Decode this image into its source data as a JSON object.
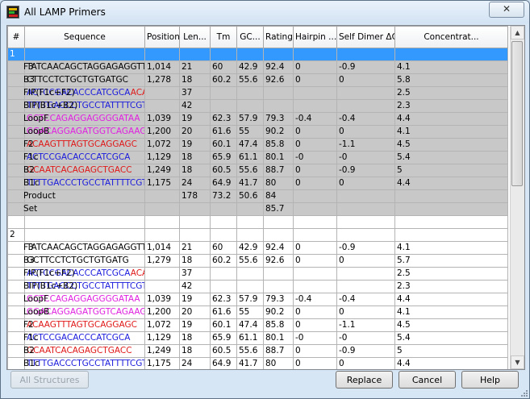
{
  "window": {
    "title": "All LAMP Primers",
    "close_glyph": "✕"
  },
  "colors": {
    "blue_seq": "#1a1adc",
    "red_seq": "#e01818",
    "magenta_seq": "#e020e0",
    "selection": "#3399ff",
    "row_gray": "#c8c8c8"
  },
  "columns": [
    "#",
    "Sequence",
    "Position",
    "Len...",
    "Tm",
    "GC...",
    "Rating",
    "Hairpin ...",
    "Self Dimer ΔG",
    "Concentrat..."
  ],
  "groups": [
    {
      "index": "1",
      "selected": true,
      "rows": [
        {
          "name": "F3",
          "seq": [
            {
              "t": "TATCAACAGCTAGGAGAGGTT",
              "c": "black"
            }
          ],
          "pos": "1,014",
          "len": "21",
          "tm": "60",
          "gc": "42.9",
          "rating": "92.4",
          "hairpin": "0",
          "dimer": "-0.9",
          "conc": "4.1",
          "light": false
        },
        {
          "name": "B3",
          "seq": [
            {
              "t": "CTTCCTCTGCTGTGATGC",
              "c": "black"
            }
          ],
          "pos": "1,278",
          "len": "18",
          "tm": "60.2",
          "gc": "55.6",
          "rating": "92.6",
          "hairpin": "0",
          "dimer": "0",
          "conc": "5.8",
          "light": false
        },
        {
          "name": "FIP(F1c+F2)",
          "seq": [
            {
              "t": "ACTCCGACACCCATCGCA",
              "c": "blue"
            },
            {
              "t": "ACAAGTTTAGTGCAGGAGC",
              "c": "red"
            }
          ],
          "pos": "",
          "len": "37",
          "tm": "",
          "gc": "",
          "rating": "",
          "hairpin": "",
          "dimer": "",
          "conc": "2.5",
          "light": false
        },
        {
          "name": "BIP(B1c+B2)",
          "seq": [
            {
              "t": "TTTTGACCCTGCCTATTTTCGTCGCAATCACAGAGCTGACC",
              "c": "blue"
            }
          ],
          "pos": "",
          "len": "42",
          "tm": "",
          "gc": "",
          "rating": "",
          "hairpin": "",
          "dimer": "",
          "conc": "2.3",
          "light": false
        },
        {
          "name": "LoopF",
          "seq": [
            {
              "t": "GCTCCAGAGGAGGGGATAA",
              "c": "magenta"
            }
          ],
          "pos": "1,039",
          "len": "19",
          "tm": "62.3",
          "gc": "57.9",
          "rating": "79.3",
          "hairpin": "-0.4",
          "dimer": "-0.4",
          "conc": "4.4",
          "light": false
        },
        {
          "name": "LoopB",
          "seq": [
            {
              "t": "GGACAGGAGATGGTCAGAAG",
              "c": "magenta"
            }
          ],
          "pos": "1,200",
          "len": "20",
          "tm": "61.6",
          "gc": "55",
          "rating": "90.2",
          "hairpin": "0",
          "dimer": "0",
          "conc": "4.1",
          "light": false
        },
        {
          "name": "F2",
          "seq": [
            {
              "t": "ACAAGTTTAGTGCAGGAGC",
              "c": "red"
            }
          ],
          "pos": "1,072",
          "len": "19",
          "tm": "60.1",
          "gc": "47.4",
          "rating": "85.8",
          "hairpin": "0",
          "dimer": "-1.1",
          "conc": "4.5",
          "light": false
        },
        {
          "name": "F1c",
          "seq": [
            {
              "t": "ACTCCGACACCCATCGCA",
              "c": "blue"
            }
          ],
          "pos": "1,129",
          "len": "18",
          "tm": "65.9",
          "gc": "61.1",
          "rating": "80.1",
          "hairpin": "-0",
          "dimer": "-0",
          "conc": "5.4",
          "light": false
        },
        {
          "name": "B2",
          "seq": [
            {
              "t": "GCAATCACAGAGCTGACC",
              "c": "red"
            }
          ],
          "pos": "1,249",
          "len": "18",
          "tm": "60.5",
          "gc": "55.6",
          "rating": "88.7",
          "hairpin": "0",
          "dimer": "-0.9",
          "conc": "5",
          "light": false
        },
        {
          "name": "B1c",
          "seq": [
            {
              "t": "TTTTGACCCTGCCTATTTTCGTC",
              "c": "blue"
            }
          ],
          "pos": "1,175",
          "len": "24",
          "tm": "64.9",
          "gc": "41.7",
          "rating": "80",
          "hairpin": "0",
          "dimer": "0",
          "conc": "4.4",
          "light": false
        },
        {
          "name": "Product",
          "seq": [],
          "pos": "",
          "len": "178",
          "tm": "73.2",
          "gc": "50.6",
          "rating": "84",
          "hairpin": "",
          "dimer": "",
          "conc": "",
          "light": false
        },
        {
          "name": "Set",
          "seq": [],
          "pos": "",
          "len": "",
          "tm": "",
          "gc": "",
          "rating": "85.7",
          "hairpin": "",
          "dimer": "",
          "conc": "",
          "light": false
        }
      ]
    },
    {
      "index": "2",
      "selected": false,
      "rows": [
        {
          "name": "F3",
          "seq": [
            {
              "t": "TATCAACAGCTAGGAGAGGTT",
              "c": "black"
            }
          ],
          "pos": "1,014",
          "len": "21",
          "tm": "60",
          "gc": "42.9",
          "rating": "92.4",
          "hairpin": "0",
          "dimer": "-0.9",
          "conc": "4.1",
          "light": true
        },
        {
          "name": "B3",
          "seq": [
            {
              "t": "GCTTCCTCTGCTGTGATG",
              "c": "black"
            }
          ],
          "pos": "1,279",
          "len": "18",
          "tm": "60.2",
          "gc": "55.6",
          "rating": "92.6",
          "hairpin": "0",
          "dimer": "0",
          "conc": "5.7",
          "light": true
        },
        {
          "name": "FIP(F1c+F2)",
          "seq": [
            {
              "t": "ACTCCGACACCCATCGCA",
              "c": "blue"
            },
            {
              "t": "ACAAGTTTAGTGCAGGAGC",
              "c": "red"
            }
          ],
          "pos": "",
          "len": "37",
          "tm": "",
          "gc": "",
          "rating": "",
          "hairpin": "",
          "dimer": "",
          "conc": "2.5",
          "light": true
        },
        {
          "name": "BIP(B1c+B2)",
          "seq": [
            {
              "t": "TTTTGACCCTGCCTATTTTCGTCGCAATCACAGAGCTGACC",
              "c": "blue"
            }
          ],
          "pos": "",
          "len": "42",
          "tm": "",
          "gc": "",
          "rating": "",
          "hairpin": "",
          "dimer": "",
          "conc": "2.3",
          "light": true
        },
        {
          "name": "LoopF",
          "seq": [
            {
              "t": "GCTCCAGAGGAGGGGATAA",
              "c": "magenta"
            }
          ],
          "pos": "1,039",
          "len": "19",
          "tm": "62.3",
          "gc": "57.9",
          "rating": "79.3",
          "hairpin": "-0.4",
          "dimer": "-0.4",
          "conc": "4.4",
          "light": true
        },
        {
          "name": "LoopB",
          "seq": [
            {
              "t": "GGACAGGAGATGGTCAGAAG",
              "c": "magenta"
            }
          ],
          "pos": "1,200",
          "len": "20",
          "tm": "61.6",
          "gc": "55",
          "rating": "90.2",
          "hairpin": "0",
          "dimer": "0",
          "conc": "4.1",
          "light": true
        },
        {
          "name": "F2",
          "seq": [
            {
              "t": "ACAAGTTTAGTGCAGGAGC",
              "c": "red"
            }
          ],
          "pos": "1,072",
          "len": "19",
          "tm": "60.1",
          "gc": "47.4",
          "rating": "85.8",
          "hairpin": "0",
          "dimer": "-1.1",
          "conc": "4.5",
          "light": true
        },
        {
          "name": "F1c",
          "seq": [
            {
              "t": "ACTCCGACACCCATCGCA",
              "c": "blue"
            }
          ],
          "pos": "1,129",
          "len": "18",
          "tm": "65.9",
          "gc": "61.1",
          "rating": "80.1",
          "hairpin": "-0",
          "dimer": "-0",
          "conc": "5.4",
          "light": true
        },
        {
          "name": "B2",
          "seq": [
            {
              "t": "GCAATCACAGAGCTGACC",
              "c": "red"
            }
          ],
          "pos": "1,249",
          "len": "18",
          "tm": "60.5",
          "gc": "55.6",
          "rating": "88.7",
          "hairpin": "0",
          "dimer": "-0.9",
          "conc": "5",
          "light": true
        },
        {
          "name": "B1c",
          "seq": [
            {
              "t": "TTTTGACCCTGCCTATTTTCGTC",
              "c": "blue"
            }
          ],
          "pos": "1,175",
          "len": "24",
          "tm": "64.9",
          "gc": "41.7",
          "rating": "80",
          "hairpin": "0",
          "dimer": "0",
          "conc": "4.4",
          "light": true
        }
      ]
    }
  ],
  "buttons": {
    "all_structures": "All Structures",
    "replace": "Replace",
    "cancel": "Cancel",
    "help": "Help"
  },
  "scrollbar": {
    "up_glyph": "▲",
    "down_glyph": "▼"
  }
}
